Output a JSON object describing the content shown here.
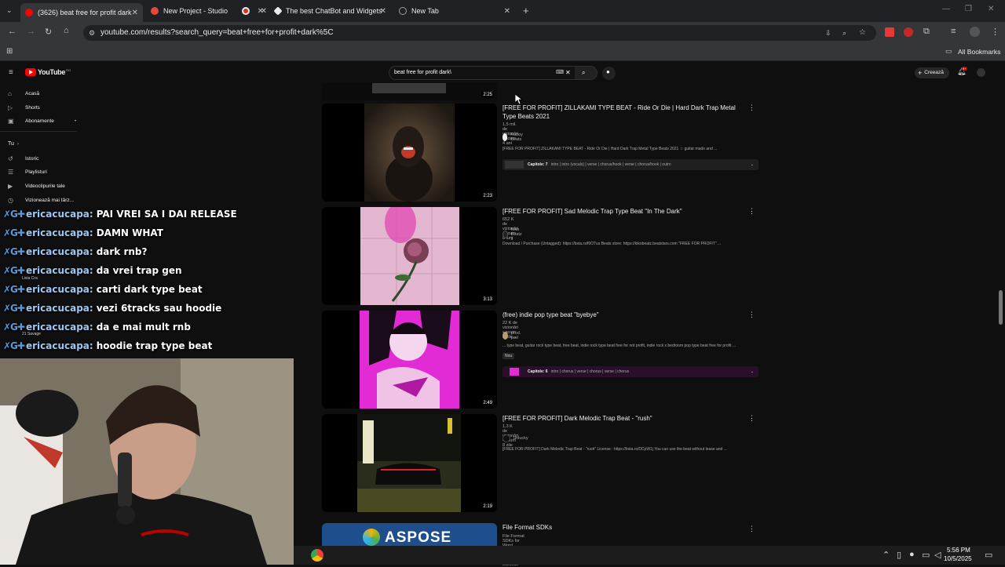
{
  "browser": {
    "tabs": [
      {
        "title": "(3626) beat free for profit dark",
        "active": true,
        "favicon_color": "#ff0000"
      },
      {
        "title": "New Project - Studio",
        "active": false,
        "favicon_color": "#e5483a"
      },
      {
        "title": "",
        "active": false,
        "favicon_color": "#d93025"
      },
      {
        "title": "The best ChatBot and Widgets",
        "active": false,
        "favicon_color": "#e8eaed"
      },
      {
        "title": "New Tab",
        "active": false,
        "favicon_color": "#9aa0a6"
      }
    ],
    "url": "youtube.com/results?search_query=beat+free+for+profit+dark%5C",
    "bookmarks_label": "All Bookmarks"
  },
  "youtube": {
    "logo": "YouTube",
    "logo_region": "RO",
    "search_value": "beat free for profit dark\\",
    "create_label": "Creează",
    "notification_count": "9+",
    "sidebar": {
      "items": [
        {
          "label": "Acasă",
          "icon": "home-icon"
        },
        {
          "label": "Shorts",
          "icon": "shorts-icon"
        },
        {
          "label": "Abonamente",
          "icon": "subscriptions-icon"
        }
      ],
      "you_label": "Tu",
      "you_items": [
        {
          "label": "Istoric",
          "icon": "history-icon"
        },
        {
          "label": "Playlisturi",
          "icon": "playlist-icon"
        },
        {
          "label": "Videoclipurile tale",
          "icon": "video-icon"
        },
        {
          "label": "Vizionează mai târz...",
          "icon": "clock-icon"
        }
      ],
      "partial_channels": [
        "Livia Cra",
        "21 Savage"
      ]
    },
    "top_partial_duration": "2:25",
    "videos": [
      {
        "title": "[FREE FOR PROFIT] ZILLAKAMI TYPE BEAT - Ride Or Die | Hard Dark Trap Metal Type Beats 2021",
        "meta": "1,5 mil. de vizionări • acum 4 ani",
        "channel": "Kuboy Beats",
        "description": "[FREE FOR PROFIT] ZILLAKAMI TYPE BEAT - Ride Or Die | Hard Dark Trap Metal Type Beats 2021 ☆ guitar made and ...",
        "duration": "2:23",
        "chapters_label": "Capitole: 7",
        "chapters": "intro | intro (vocals) | verse | chorus/hook | verse | chorus/hook | outro"
      },
      {
        "title": "[FREE FOR PROFIT] Sad Melodic Trap Type Beat \"In The Dark\"",
        "meta": "652 K de vizionări • acum 8 luni",
        "channel": "Kiko Beatz II",
        "description": "Download / Purchase (Untagged): https://bsta.rs/f0OTus Beats store: https://kikobeatz.beatstars.com \"FREE FOR PROFIT\" ...",
        "duration": "3:13"
      },
      {
        "title": "(free) indie pop type beat \"byebye\"",
        "meta": "22 K de vizionări • acum 3 zile",
        "channel": "prod. pæl",
        "description": "... type beat, guitar rock type beat, free beat, indie rock type beat free for not profit, indie rock x bedroom pop type beat free for profit ...",
        "badge": "Nou",
        "duration": "2:49",
        "chapters_label": "Capitole: 6",
        "chapters": "intro | chorus | verse | chorus | verse | chorus"
      },
      {
        "title": "[FREE FOR PROFIT] Dark Melodic Trap Beat - \"rush\"",
        "meta": "1,3 K de vizionări • acum 8 zile",
        "channel": "unlucky",
        "description": "[FREE FOR PROFIT] Dark Melodic Trap Beat - \"rush\" License : https://bsta.rs/DCpW1j You can use the beat without lease and ...",
        "duration": "2:19"
      },
      {
        "title": "File Format SDKs",
        "meta": "File Format SDKs for Word, Excel, PDF, Email, PowerPoint, Barcode",
        "thumb_text": "ASPOSE"
      }
    ]
  },
  "chat": {
    "user": "ericacucapa:",
    "badges": "✗G✚",
    "messages": [
      "PAI VREI SA I DAI RELEASE",
      "DAMN WHAT",
      "dark rnb?",
      "da vrei trap gen",
      "carti dark type beat",
      "vezi 6tracks sau hoodie",
      "da e mai mult rnb",
      "hoodie trap type beat"
    ]
  },
  "taskbar": {
    "time": "5:56 PM",
    "date": "10/5/2025"
  }
}
